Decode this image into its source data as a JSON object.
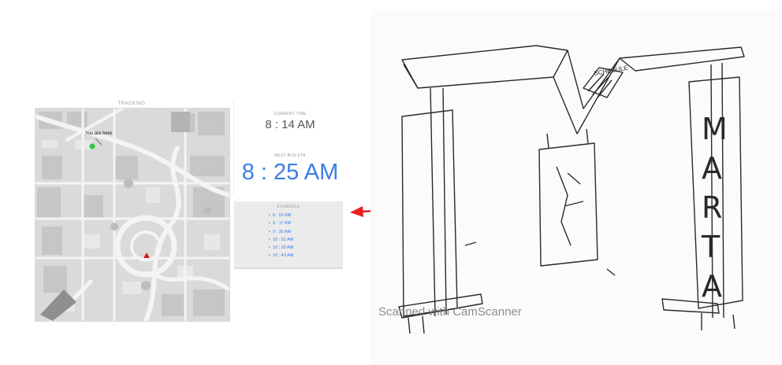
{
  "tracking": {
    "title": "TRACKING",
    "marker_label": "You are here",
    "marker_color": "#2ecc40",
    "bus_marker_color": "#d71c1c"
  },
  "info": {
    "current_time_label": "CURRENT TIME",
    "current_time": "8 : 14 AM",
    "next_eta_label": "NEXT BUS ETA",
    "next_eta": "8 : 25 AM",
    "accent_color": "#3b7de0"
  },
  "schedule": {
    "title": "SCHEDULE",
    "times": [
      "8 : 52 AM",
      "9 : 17 AM",
      "9 : 35 AM",
      "10 : 01 AM",
      "10 : 20 AM",
      "10 : 43 AM"
    ]
  },
  "sketch": {
    "sign_letters": [
      "M",
      "A",
      "R",
      "T",
      "A"
    ],
    "board_note": "SCHEDULE",
    "watermark": "Scanned with CamScanner",
    "arrow_color": "#e8201e"
  }
}
